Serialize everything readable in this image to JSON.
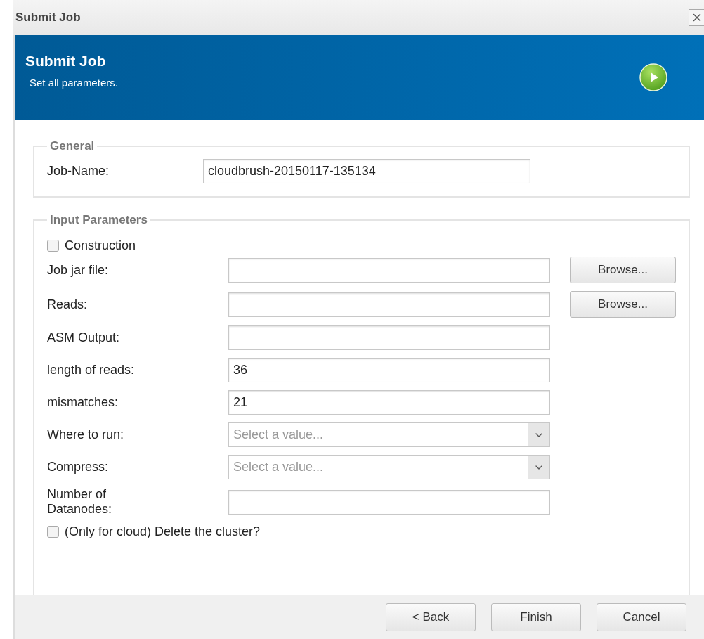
{
  "window": {
    "title": "Submit Job"
  },
  "header": {
    "title": "Submit Job",
    "subtitle": "Set all parameters."
  },
  "general": {
    "legend": "General",
    "fields": [
      {
        "label": "Job-Name:",
        "kind": "text",
        "value": "cloudbrush-20150117-135134"
      }
    ]
  },
  "input_parameters": {
    "legend": "Input Parameters",
    "construction": {
      "label": "Construction",
      "checked": false
    },
    "fields": [
      {
        "label": "Job jar file:",
        "kind": "text",
        "browse": "Browse..."
      },
      {
        "label": "Reads:",
        "kind": "text",
        "browse": "Browse..."
      },
      {
        "label": "ASM Output:",
        "kind": "text"
      },
      {
        "label": "length of reads:",
        "kind": "text",
        "value": "36"
      },
      {
        "label": "mismatches:",
        "kind": "text",
        "value": "21"
      },
      {
        "label": "Where to run:",
        "kind": "select",
        "placeholder": "Select a value..."
      },
      {
        "label": "Compress:",
        "kind": "select",
        "placeholder": "Select a value..."
      },
      {
        "label": "Number of Datanodes:",
        "kind": "text"
      }
    ],
    "delete_cluster": {
      "label": "(Only for cloud) Delete the cluster?",
      "checked": false
    }
  },
  "buttons": [
    "< Back",
    "Finish",
    "Cancel"
  ]
}
